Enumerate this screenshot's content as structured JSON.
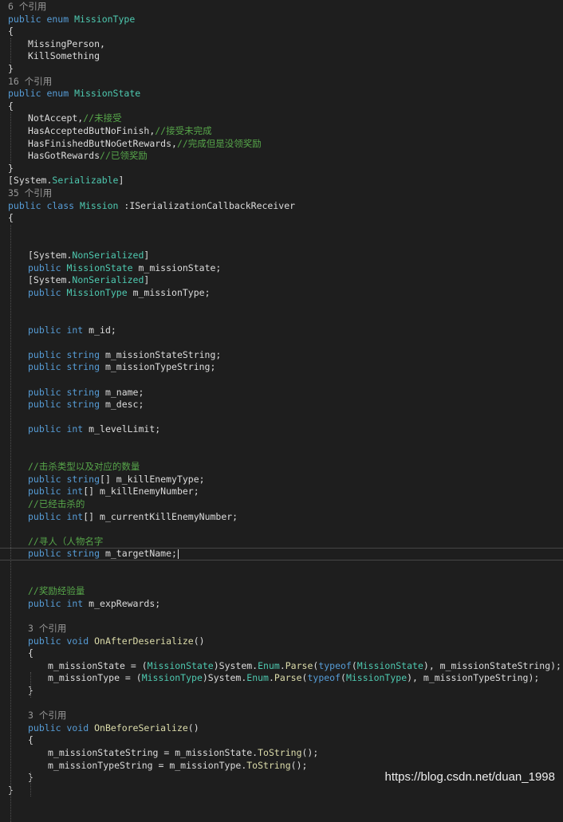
{
  "colors": {
    "background": "#1e1e1e",
    "keyword": "#569cd6",
    "type": "#4ec9b0",
    "comment": "#57a64a",
    "default": "#dcdcdc",
    "codelens": "#999999",
    "method": "#dcdcaa"
  },
  "lines": [
    {
      "type": "codelens",
      "indent": 0,
      "text": "6 个引用"
    },
    {
      "indent": 0,
      "spans": [
        {
          "t": "public enum ",
          "c": "keyword"
        },
        {
          "t": "MissionType",
          "c": "type"
        }
      ]
    },
    {
      "indent": 0,
      "spans": [
        {
          "t": "{"
        }
      ]
    },
    {
      "indent": 1,
      "spans": [
        {
          "t": "MissingPerson,"
        }
      ]
    },
    {
      "indent": 1,
      "spans": [
        {
          "t": "KillSomething"
        }
      ]
    },
    {
      "indent": 0,
      "spans": [
        {
          "t": "}"
        }
      ]
    },
    {
      "type": "codelens",
      "indent": 0,
      "text": "16 个引用"
    },
    {
      "indent": 0,
      "spans": [
        {
          "t": "public enum ",
          "c": "keyword"
        },
        {
          "t": "MissionState",
          "c": "type"
        }
      ]
    },
    {
      "indent": 0,
      "spans": [
        {
          "t": "{"
        }
      ]
    },
    {
      "indent": 1,
      "spans": [
        {
          "t": "NotAccept,"
        },
        {
          "t": "//未接受",
          "c": "comment"
        }
      ]
    },
    {
      "indent": 1,
      "spans": [
        {
          "t": "HasAcceptedButNoFinish,"
        },
        {
          "t": "//接受未完成",
          "c": "comment"
        }
      ]
    },
    {
      "indent": 1,
      "spans": [
        {
          "t": "HasFinishedButNoGetRewards,"
        },
        {
          "t": "//完成但是没领奖励",
          "c": "comment"
        }
      ]
    },
    {
      "indent": 1,
      "spans": [
        {
          "t": "HasGotRewards"
        },
        {
          "t": "//已领奖励",
          "c": "comment"
        }
      ]
    },
    {
      "indent": 0,
      "spans": [
        {
          "t": "}"
        }
      ]
    },
    {
      "indent": 0,
      "spans": [
        {
          "t": "[System."
        },
        {
          "t": "Serializable",
          "c": "type"
        },
        {
          "t": "]"
        }
      ]
    },
    {
      "type": "codelens",
      "indent": 0,
      "text": "35 个引用"
    },
    {
      "indent": 0,
      "spans": [
        {
          "t": "public class ",
          "c": "keyword"
        },
        {
          "t": "Mission",
          "c": "type"
        },
        {
          "t": " :ISerializationCallbackReceiver"
        }
      ]
    },
    {
      "indent": 0,
      "spans": [
        {
          "t": "{"
        }
      ]
    },
    {
      "indent": 0,
      "spans": []
    },
    {
      "indent": 0,
      "spans": []
    },
    {
      "indent": 1,
      "spans": [
        {
          "t": "[System."
        },
        {
          "t": "NonSerialized",
          "c": "type"
        },
        {
          "t": "]"
        }
      ]
    },
    {
      "indent": 1,
      "spans": [
        {
          "t": "public ",
          "c": "keyword"
        },
        {
          "t": "MissionState",
          "c": "type"
        },
        {
          "t": " m_missionState;"
        }
      ]
    },
    {
      "indent": 1,
      "spans": [
        {
          "t": "[System."
        },
        {
          "t": "NonSerialized",
          "c": "type"
        },
        {
          "t": "]"
        }
      ]
    },
    {
      "indent": 1,
      "spans": [
        {
          "t": "public ",
          "c": "keyword"
        },
        {
          "t": "MissionType",
          "c": "type"
        },
        {
          "t": " m_missionType;"
        }
      ]
    },
    {
      "indent": 0,
      "spans": []
    },
    {
      "indent": 0,
      "spans": []
    },
    {
      "indent": 1,
      "spans": [
        {
          "t": "public int ",
          "c": "keyword"
        },
        {
          "t": "m_id;"
        }
      ]
    },
    {
      "indent": 0,
      "spans": []
    },
    {
      "indent": 1,
      "spans": [
        {
          "t": "public string ",
          "c": "keyword"
        },
        {
          "t": "m_missionStateString;"
        }
      ]
    },
    {
      "indent": 1,
      "spans": [
        {
          "t": "public string ",
          "c": "keyword"
        },
        {
          "t": "m_missionTypeString;"
        }
      ]
    },
    {
      "indent": 0,
      "spans": []
    },
    {
      "indent": 1,
      "spans": [
        {
          "t": "public string ",
          "c": "keyword"
        },
        {
          "t": "m_name;"
        }
      ]
    },
    {
      "indent": 1,
      "spans": [
        {
          "t": "public string ",
          "c": "keyword"
        },
        {
          "t": "m_desc;"
        }
      ]
    },
    {
      "indent": 0,
      "spans": []
    },
    {
      "indent": 1,
      "spans": [
        {
          "t": "public int ",
          "c": "keyword"
        },
        {
          "t": "m_levelLimit;"
        }
      ]
    },
    {
      "indent": 0,
      "spans": []
    },
    {
      "indent": 0,
      "spans": []
    },
    {
      "indent": 1,
      "spans": [
        {
          "t": "//击杀类型以及对应的数量",
          "c": "comment"
        }
      ]
    },
    {
      "indent": 1,
      "spans": [
        {
          "t": "public string",
          "c": "keyword"
        },
        {
          "t": "[] m_killEnemyType;"
        }
      ]
    },
    {
      "indent": 1,
      "spans": [
        {
          "t": "public int",
          "c": "keyword"
        },
        {
          "t": "[] m_killEnemyNumber;"
        }
      ]
    },
    {
      "indent": 1,
      "spans": [
        {
          "t": "//已经击杀的",
          "c": "comment"
        }
      ]
    },
    {
      "indent": 1,
      "spans": [
        {
          "t": "public int",
          "c": "keyword"
        },
        {
          "t": "[] m_currentKillEnemyNumber;"
        }
      ]
    },
    {
      "indent": 0,
      "spans": []
    },
    {
      "indent": 1,
      "spans": [
        {
          "t": "//寻人（人物名字",
          "c": "comment"
        }
      ]
    },
    {
      "type": "current",
      "indent": 1,
      "spans": [
        {
          "t": "public string ",
          "c": "keyword"
        },
        {
          "t": "m_targetName;"
        }
      ]
    },
    {
      "indent": 0,
      "spans": []
    },
    {
      "indent": 0,
      "spans": []
    },
    {
      "indent": 1,
      "spans": [
        {
          "t": "//奖励经验量",
          "c": "comment"
        }
      ]
    },
    {
      "indent": 1,
      "spans": [
        {
          "t": "public int ",
          "c": "keyword"
        },
        {
          "t": "m_expRewards;"
        }
      ]
    },
    {
      "indent": 0,
      "spans": []
    },
    {
      "type": "codelens",
      "indent": 1,
      "text": "3 个引用"
    },
    {
      "indent": 1,
      "spans": [
        {
          "t": "public void ",
          "c": "keyword"
        },
        {
          "t": "OnAfterDeserialize",
          "c": "method"
        },
        {
          "t": "()"
        }
      ]
    },
    {
      "indent": 1,
      "spans": [
        {
          "t": "{"
        }
      ]
    },
    {
      "indent": 2,
      "spans": [
        {
          "t": "m_missionState = ("
        },
        {
          "t": "MissionState",
          "c": "type"
        },
        {
          "t": ")System."
        },
        {
          "t": "Enum",
          "c": "type"
        },
        {
          "t": "."
        },
        {
          "t": "Parse",
          "c": "method"
        },
        {
          "t": "("
        },
        {
          "t": "typeof",
          "c": "keyword"
        },
        {
          "t": "("
        },
        {
          "t": "MissionState",
          "c": "type"
        },
        {
          "t": "), m_missionStateString);"
        }
      ]
    },
    {
      "indent": 2,
      "spans": [
        {
          "t": "m_missionType = ("
        },
        {
          "t": "MissionType",
          "c": "type"
        },
        {
          "t": ")System."
        },
        {
          "t": "Enum",
          "c": "type"
        },
        {
          "t": "."
        },
        {
          "t": "Parse",
          "c": "method"
        },
        {
          "t": "("
        },
        {
          "t": "typeof",
          "c": "keyword"
        },
        {
          "t": "("
        },
        {
          "t": "MissionType",
          "c": "type"
        },
        {
          "t": "), m_missionTypeString);"
        }
      ]
    },
    {
      "indent": 1,
      "spans": [
        {
          "t": "}"
        }
      ]
    },
    {
      "indent": 0,
      "spans": []
    },
    {
      "type": "codelens",
      "indent": 1,
      "text": "3 个引用"
    },
    {
      "indent": 1,
      "spans": [
        {
          "t": "public void ",
          "c": "keyword"
        },
        {
          "t": "OnBeforeSerialize",
          "c": "method"
        },
        {
          "t": "()"
        }
      ]
    },
    {
      "indent": 1,
      "spans": [
        {
          "t": "{"
        }
      ]
    },
    {
      "indent": 2,
      "spans": [
        {
          "t": "m_missionStateString = m_missionState."
        },
        {
          "t": "ToString",
          "c": "method"
        },
        {
          "t": "();"
        }
      ]
    },
    {
      "indent": 2,
      "spans": [
        {
          "t": "m_missionTypeString = m_missionType."
        },
        {
          "t": "ToString",
          "c": "method"
        },
        {
          "t": "();"
        }
      ]
    },
    {
      "indent": 1,
      "spans": [
        {
          "t": "}"
        }
      ]
    },
    {
      "indent": 0,
      "spans": [
        {
          "t": "}"
        }
      ]
    }
  ],
  "watermark": "https://blog.csdn.net/duan_1998"
}
